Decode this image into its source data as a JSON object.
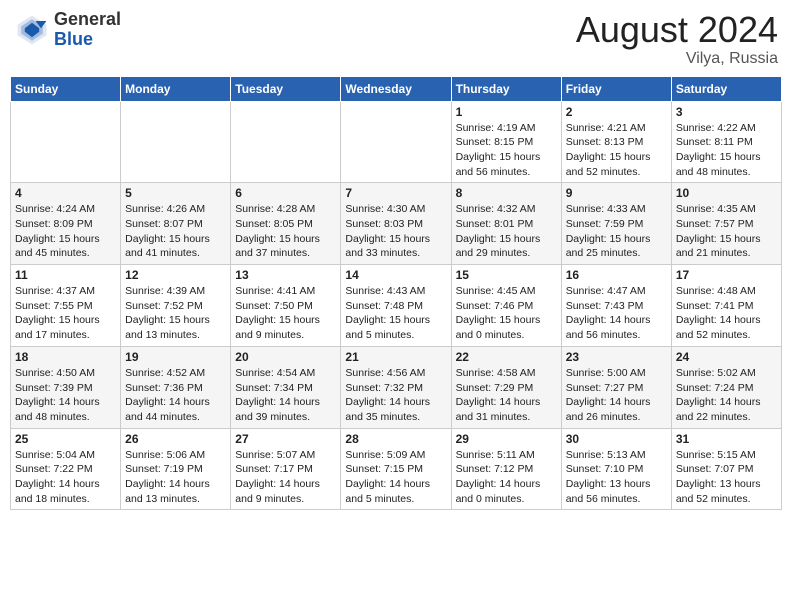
{
  "header": {
    "logo_general": "General",
    "logo_blue": "Blue",
    "month_year": "August 2024",
    "location": "Vilya, Russia"
  },
  "columns": [
    "Sunday",
    "Monday",
    "Tuesday",
    "Wednesday",
    "Thursday",
    "Friday",
    "Saturday"
  ],
  "weeks": [
    {
      "row": 1,
      "days": [
        {
          "num": "",
          "info": ""
        },
        {
          "num": "",
          "info": ""
        },
        {
          "num": "",
          "info": ""
        },
        {
          "num": "",
          "info": ""
        },
        {
          "num": "1",
          "info": "Sunrise: 4:19 AM\nSunset: 8:15 PM\nDaylight: 15 hours\nand 56 minutes."
        },
        {
          "num": "2",
          "info": "Sunrise: 4:21 AM\nSunset: 8:13 PM\nDaylight: 15 hours\nand 52 minutes."
        },
        {
          "num": "3",
          "info": "Sunrise: 4:22 AM\nSunset: 8:11 PM\nDaylight: 15 hours\nand 48 minutes."
        }
      ]
    },
    {
      "row": 2,
      "days": [
        {
          "num": "4",
          "info": "Sunrise: 4:24 AM\nSunset: 8:09 PM\nDaylight: 15 hours\nand 45 minutes."
        },
        {
          "num": "5",
          "info": "Sunrise: 4:26 AM\nSunset: 8:07 PM\nDaylight: 15 hours\nand 41 minutes."
        },
        {
          "num": "6",
          "info": "Sunrise: 4:28 AM\nSunset: 8:05 PM\nDaylight: 15 hours\nand 37 minutes."
        },
        {
          "num": "7",
          "info": "Sunrise: 4:30 AM\nSunset: 8:03 PM\nDaylight: 15 hours\nand 33 minutes."
        },
        {
          "num": "8",
          "info": "Sunrise: 4:32 AM\nSunset: 8:01 PM\nDaylight: 15 hours\nand 29 minutes."
        },
        {
          "num": "9",
          "info": "Sunrise: 4:33 AM\nSunset: 7:59 PM\nDaylight: 15 hours\nand 25 minutes."
        },
        {
          "num": "10",
          "info": "Sunrise: 4:35 AM\nSunset: 7:57 PM\nDaylight: 15 hours\nand 21 minutes."
        }
      ]
    },
    {
      "row": 3,
      "days": [
        {
          "num": "11",
          "info": "Sunrise: 4:37 AM\nSunset: 7:55 PM\nDaylight: 15 hours\nand 17 minutes."
        },
        {
          "num": "12",
          "info": "Sunrise: 4:39 AM\nSunset: 7:52 PM\nDaylight: 15 hours\nand 13 minutes."
        },
        {
          "num": "13",
          "info": "Sunrise: 4:41 AM\nSunset: 7:50 PM\nDaylight: 15 hours\nand 9 minutes."
        },
        {
          "num": "14",
          "info": "Sunrise: 4:43 AM\nSunset: 7:48 PM\nDaylight: 15 hours\nand 5 minutes."
        },
        {
          "num": "15",
          "info": "Sunrise: 4:45 AM\nSunset: 7:46 PM\nDaylight: 15 hours\nand 0 minutes."
        },
        {
          "num": "16",
          "info": "Sunrise: 4:47 AM\nSunset: 7:43 PM\nDaylight: 14 hours\nand 56 minutes."
        },
        {
          "num": "17",
          "info": "Sunrise: 4:48 AM\nSunset: 7:41 PM\nDaylight: 14 hours\nand 52 minutes."
        }
      ]
    },
    {
      "row": 4,
      "days": [
        {
          "num": "18",
          "info": "Sunrise: 4:50 AM\nSunset: 7:39 PM\nDaylight: 14 hours\nand 48 minutes."
        },
        {
          "num": "19",
          "info": "Sunrise: 4:52 AM\nSunset: 7:36 PM\nDaylight: 14 hours\nand 44 minutes."
        },
        {
          "num": "20",
          "info": "Sunrise: 4:54 AM\nSunset: 7:34 PM\nDaylight: 14 hours\nand 39 minutes."
        },
        {
          "num": "21",
          "info": "Sunrise: 4:56 AM\nSunset: 7:32 PM\nDaylight: 14 hours\nand 35 minutes."
        },
        {
          "num": "22",
          "info": "Sunrise: 4:58 AM\nSunset: 7:29 PM\nDaylight: 14 hours\nand 31 minutes."
        },
        {
          "num": "23",
          "info": "Sunrise: 5:00 AM\nSunset: 7:27 PM\nDaylight: 14 hours\nand 26 minutes."
        },
        {
          "num": "24",
          "info": "Sunrise: 5:02 AM\nSunset: 7:24 PM\nDaylight: 14 hours\nand 22 minutes."
        }
      ]
    },
    {
      "row": 5,
      "days": [
        {
          "num": "25",
          "info": "Sunrise: 5:04 AM\nSunset: 7:22 PM\nDaylight: 14 hours\nand 18 minutes."
        },
        {
          "num": "26",
          "info": "Sunrise: 5:06 AM\nSunset: 7:19 PM\nDaylight: 14 hours\nand 13 minutes."
        },
        {
          "num": "27",
          "info": "Sunrise: 5:07 AM\nSunset: 7:17 PM\nDaylight: 14 hours\nand 9 minutes."
        },
        {
          "num": "28",
          "info": "Sunrise: 5:09 AM\nSunset: 7:15 PM\nDaylight: 14 hours\nand 5 minutes."
        },
        {
          "num": "29",
          "info": "Sunrise: 5:11 AM\nSunset: 7:12 PM\nDaylight: 14 hours\nand 0 minutes."
        },
        {
          "num": "30",
          "info": "Sunrise: 5:13 AM\nSunset: 7:10 PM\nDaylight: 13 hours\nand 56 minutes."
        },
        {
          "num": "31",
          "info": "Sunrise: 5:15 AM\nSunset: 7:07 PM\nDaylight: 13 hours\nand 52 minutes."
        }
      ]
    }
  ]
}
